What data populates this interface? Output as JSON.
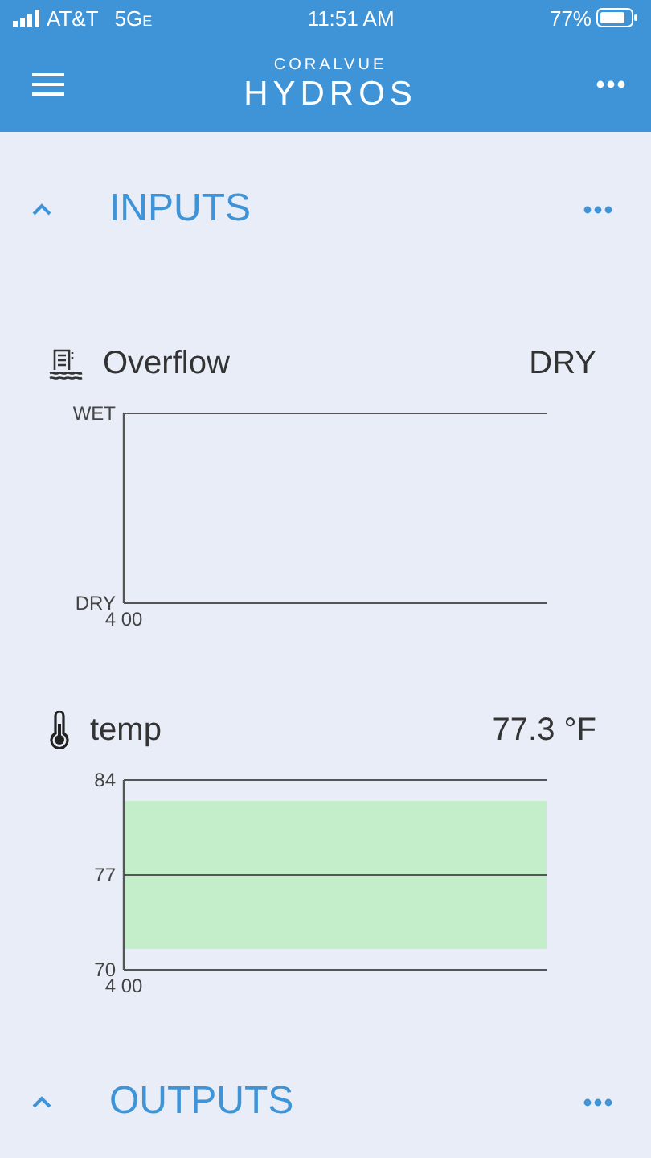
{
  "status_bar": {
    "carrier": "AT&T",
    "network": "5G",
    "network_suffix": "E",
    "time": "11:51 AM",
    "battery": "77%"
  },
  "app_bar": {
    "brand_top": "CORALVUE",
    "brand_main": "HYDROS"
  },
  "sections": [
    {
      "title": "INPUTS",
      "expanded": true,
      "items": [
        {
          "kind": "overflow",
          "name": "Overflow",
          "reading": "DRY",
          "chart": {
            "y_labels": [
              "WET",
              "DRY"
            ],
            "x_label": "4 00"
          }
        },
        {
          "kind": "temperature",
          "name": "temp",
          "reading": "77.3 °F",
          "chart_data": {
            "type": "line",
            "categories": [
              "4 00",
              null
            ],
            "ylim": [
              70,
              84
            ],
            "yticks": [
              84,
              77,
              70
            ]
          }
        }
      ]
    },
    {
      "title": "OUTPUTS",
      "expanded": true
    }
  ]
}
